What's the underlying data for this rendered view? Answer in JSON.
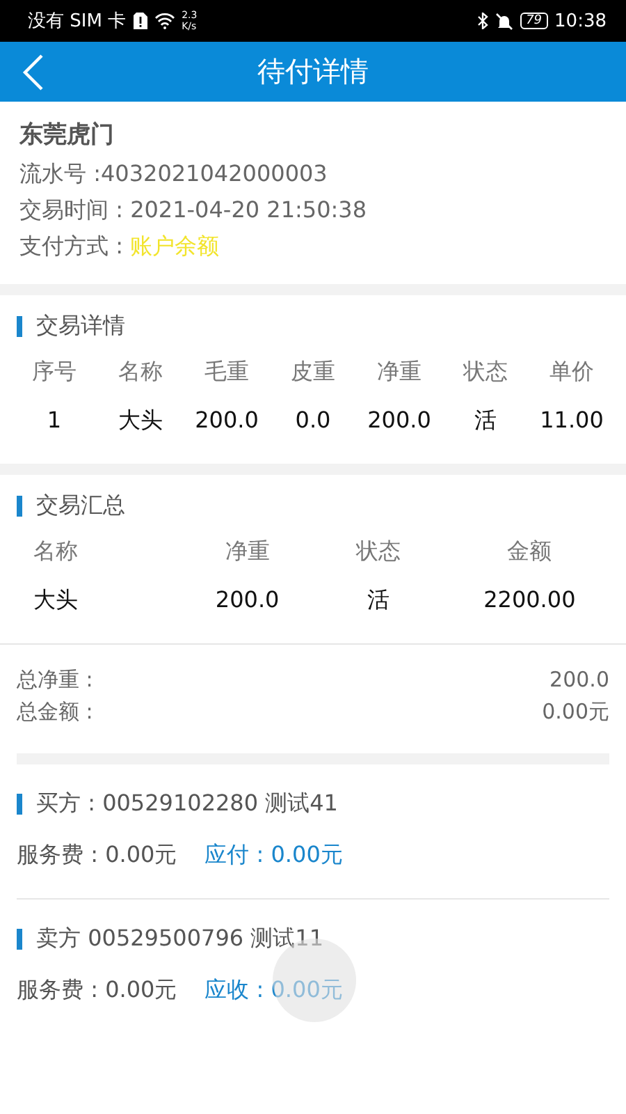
{
  "status_bar": {
    "carrier": "没有 SIM 卡",
    "speed_value": "2.3",
    "speed_unit": "K/s",
    "battery": "79",
    "time": "10:38"
  },
  "header": {
    "title": "待付详情"
  },
  "info": {
    "market": "东莞虎门",
    "serial": "流水号 :4032021042000003",
    "time": "交易时间 : 2021-04-20 21:50:38",
    "payment_label": "支付方式 : ",
    "payment_value": "账户余额"
  },
  "details": {
    "title": "交易详情",
    "columns": [
      "序号",
      "名称",
      "毛重",
      "皮重",
      "净重",
      "状态",
      "单价"
    ],
    "rows": [
      [
        "1",
        "大头",
        "200.0",
        "0.0",
        "200.0",
        "活",
        "11.00"
      ]
    ]
  },
  "summary": {
    "title": "交易汇总",
    "columns": [
      "名称",
      "净重",
      "状态",
      "金额"
    ],
    "rows": [
      [
        "大头",
        "200.0",
        "活",
        "2200.00"
      ]
    ]
  },
  "totals": [
    {
      "label": "总净重 :",
      "value": "200.0"
    },
    {
      "label": "总金额 :",
      "value": "0.00元"
    }
  ],
  "parties": [
    {
      "title": "买方 : 00529102280  测试41",
      "fee": "服务费 : 0.00元",
      "due": "应付 : 0.00元"
    },
    {
      "title": "卖方  00529500796  测试11",
      "fee": "服务费 : 0.00元",
      "due": "应收 : 0.00元"
    }
  ]
}
